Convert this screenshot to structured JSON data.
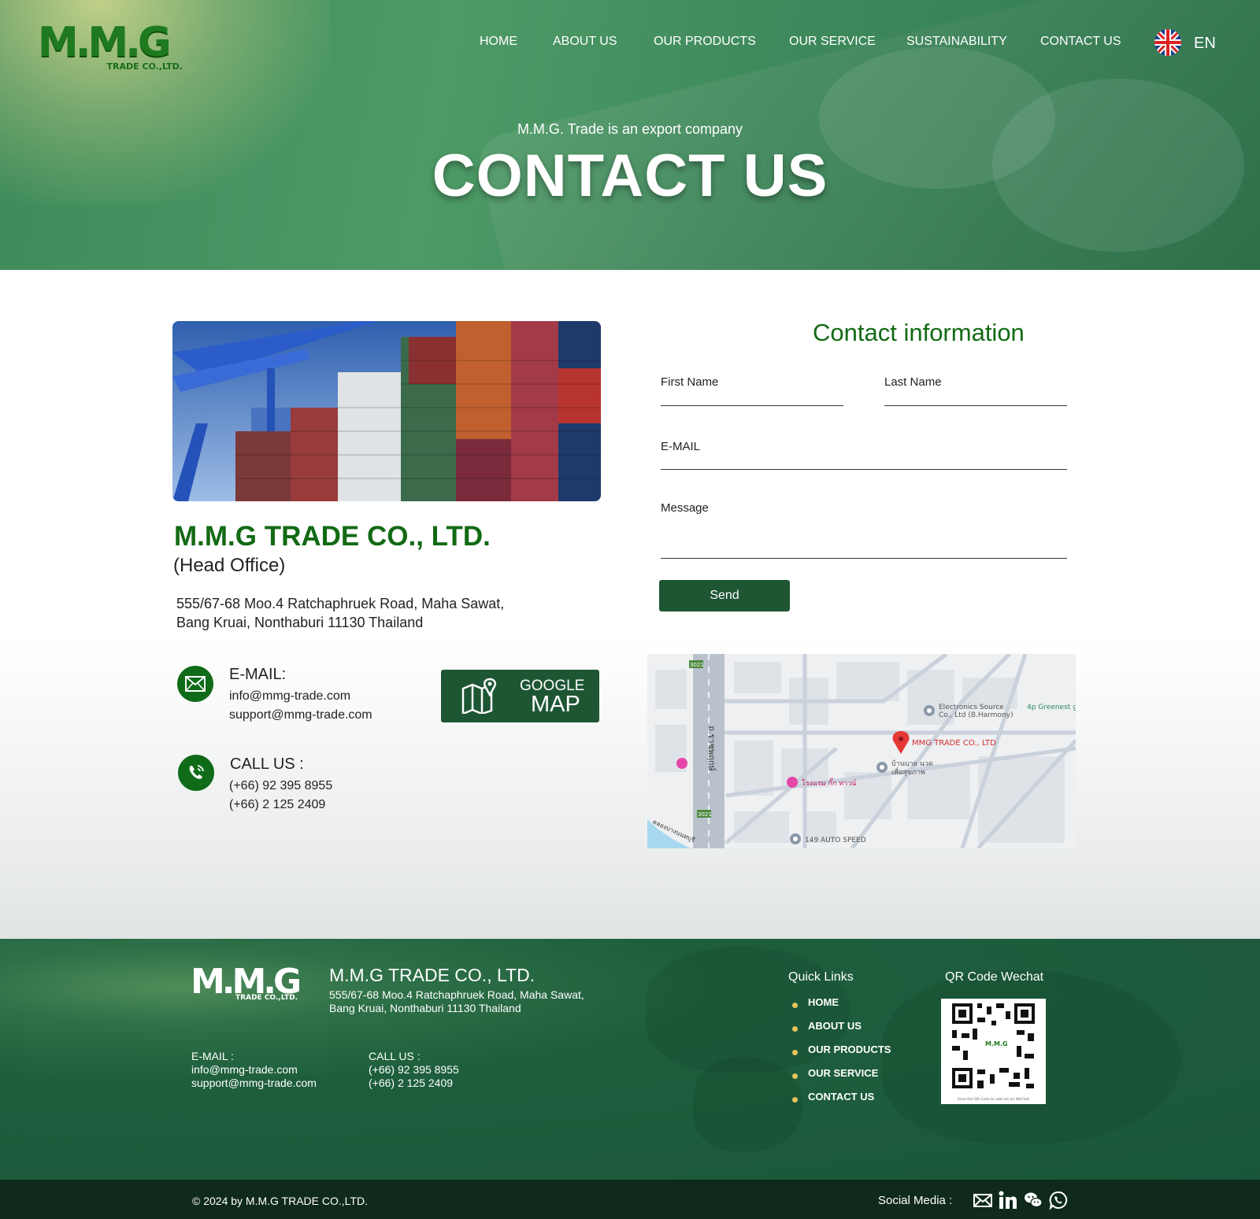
{
  "header": {
    "logo_main": "M.M.G",
    "logo_sub": "TRADE CO.,LTD.",
    "nav": [
      {
        "label": "HOME"
      },
      {
        "label": "ABOUT US"
      },
      {
        "label": "OUR PRODUCTS"
      },
      {
        "label": "OUR SERVICE"
      },
      {
        "label": "SUSTAINABILITY"
      },
      {
        "label": "CONTACT US"
      }
    ],
    "language": "EN",
    "flag_icon": "uk-flag-icon"
  },
  "hero": {
    "subtitle": "M.M.G. Trade is an export company",
    "title": "CONTACT US"
  },
  "company": {
    "name": "M.M.G TRADE CO., LTD.",
    "office": "(Head Office)",
    "address_line1": "555/67-68 Moo.4 Ratchaphruek Road, Maha Sawat,",
    "address_line2": "Bang Kruai, Nonthaburi  11130 Thailand"
  },
  "contact": {
    "email_label": "E-MAIL:",
    "email_1": "info@mmg-trade.com",
    "email_2": "support@mmg-trade.com",
    "call_label": "CALL US :",
    "phone_1": "(+66) 92 395 8955",
    "phone_2": "(+66) 2 125 2409",
    "map_button_line1": "GOOGLE",
    "map_button_line2": "MAP"
  },
  "form": {
    "title": "Contact information",
    "first_name_label": "First Name",
    "last_name_label": "Last Name",
    "email_label": "E-MAIL",
    "message_label": "Message",
    "first_name_value": "",
    "last_name_value": "",
    "email_value": "",
    "message_value": "",
    "send_label": "Send"
  },
  "map": {
    "road_label": "ถ.ราชพฤกษ์",
    "road_number": "3021",
    "pins": [
      {
        "label": "MMG TRADE CO., LTD"
      },
      {
        "label": "Electronics Source"
      },
      {
        "label": "Co., Ltd (B.Harmony)"
      },
      {
        "label": "4p Greenest g"
      },
      {
        "label": "บ้านบาย นวด"
      },
      {
        "label": "เพื่อสุขภาพ"
      },
      {
        "label": "โรงแรม กั๊ก ทาวน์"
      },
      {
        "label": "149 AUTO SPEED"
      },
      {
        "label": "คลองบางนนทบุรี"
      }
    ]
  },
  "footer": {
    "logo_main": "M.M.G",
    "logo_sub": "TRADE CO.,LTD.",
    "company": "M.M.G TRADE CO., LTD.",
    "address_line1": "555/67-68 Moo.4 Ratchaphruek Road, Maha Sawat,",
    "address_line2": "Bang Kruai, Nonthaburi  11130 Thailand",
    "email_label": "E-MAIL :",
    "email_1": "info@mmg-trade.com",
    "email_2": "support@mmg-trade.com",
    "call_label": "CALL US :",
    "phone_1": "(+66) 92 395 8955",
    "phone_2": "(+66) 2 125 2409",
    "quick_links_title": "Quick Links",
    "quick_links": [
      "HOME",
      "ABOUT US",
      "OUR PRODUCTS",
      "OUR SERVICE",
      "CONTACT US"
    ],
    "qr_title": "QR Code Wechat",
    "qr_caption": "Scan the QR Code to add me on WeChat",
    "copyright": "© 2024 by M.M.G TRADE CO.,LTD.",
    "social_label": "Social Media :",
    "social_icons": [
      "email-icon",
      "linkedin-icon",
      "wechat-icon",
      "whatsapp-icon"
    ]
  },
  "colors": {
    "brand_green": "#126a14",
    "button_green": "#1e5634",
    "footer_green": "#1a573a",
    "bottom_bar": "#0f2a1c",
    "bullet_gold": "#e6c45a"
  }
}
